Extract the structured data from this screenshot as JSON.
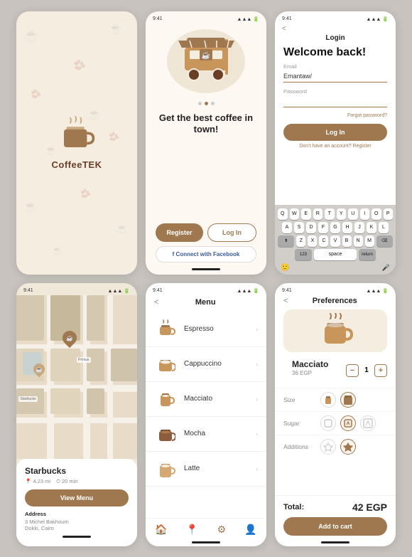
{
  "screen1": {
    "brand": "CoffeeTEK"
  },
  "screen2": {
    "status_time": "9:41",
    "title": "Get the best coffee\nin town!",
    "btn_register": "Register",
    "btn_login": "Log In",
    "btn_facebook": "f  Connect with Facebook"
  },
  "screen3": {
    "status_time": "9:41",
    "back": "<",
    "page_title": "Login",
    "welcome": "Welcome back!",
    "email_label": "Email",
    "email_value": "Emantaw/",
    "password_label": "Password",
    "forgot": "Forgot password?",
    "btn_login": "Log In",
    "register_text": "Don't have an account?",
    "register_link": "Register",
    "keyboard": {
      "row1": [
        "Q",
        "W",
        "E",
        "R",
        "T",
        "Y",
        "U",
        "I",
        "O",
        "P"
      ],
      "row2": [
        "A",
        "S",
        "D",
        "F",
        "G",
        "H",
        "J",
        "K",
        "L"
      ],
      "row3": [
        "Z",
        "X",
        "C",
        "V",
        "B",
        "N",
        "M"
      ],
      "space": "space",
      "return": "return",
      "num": "123"
    }
  },
  "screen4": {
    "status_time": "9:41",
    "store_name": "Starbucks",
    "distance": "4.23 mi",
    "time": "20 min",
    "btn_view_menu": "View Menu",
    "address_label": "Address",
    "address_line1": "3 Michel Bakhoum",
    "address_line2": "Dokki, Cairo"
  },
  "screen5": {
    "status_time": "9:41",
    "title": "Menu",
    "back": "<",
    "items": [
      {
        "name": "Espresso",
        "icon": "☕"
      },
      {
        "name": "Cappuccino",
        "icon": "☕"
      },
      {
        "name": "Macciato",
        "icon": "🥛"
      },
      {
        "name": "Mocha",
        "icon": "☕"
      },
      {
        "name": "Latte",
        "icon": "🍵"
      }
    ],
    "nav": [
      "🏠",
      "📍",
      "⚙",
      "👤"
    ]
  },
  "screen6": {
    "status_time": "9:41",
    "back": "<",
    "title": "Preferences",
    "product_icon": "☕",
    "product_name": "Macciato",
    "product_price": "36 EGP",
    "qty": "1",
    "size_label": "Size",
    "sugar_label": "Sugar",
    "additions_label": "Additions",
    "total_label": "Total:",
    "total_price": "42 EGP",
    "btn_add_cart": "Add to cart"
  }
}
